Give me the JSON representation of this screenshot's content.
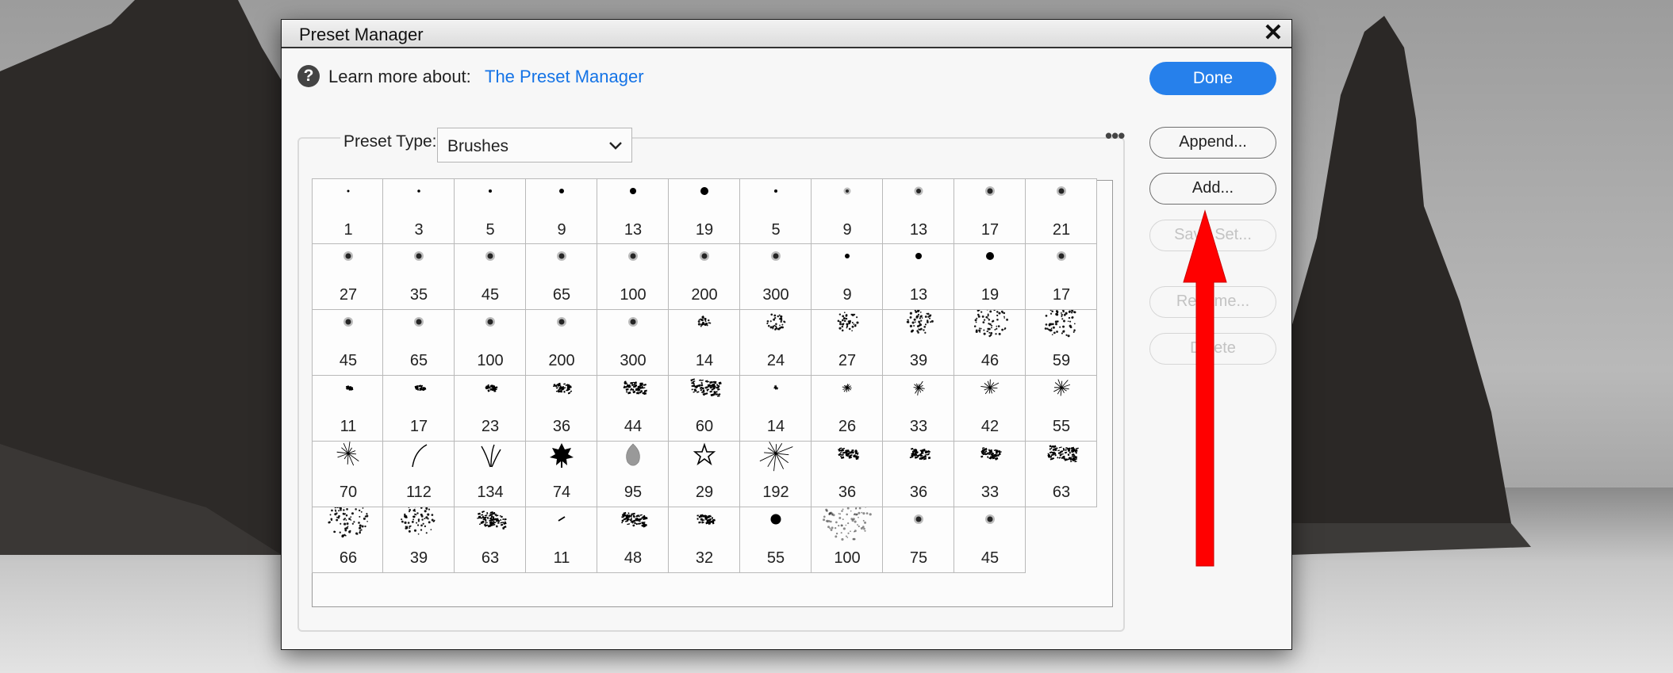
{
  "window": {
    "title": "Preset Manager"
  },
  "header": {
    "learn_label": "Learn more about:",
    "learn_link": "The Preset Manager",
    "done_label": "Done"
  },
  "preset_type": {
    "label": "Preset Type:",
    "value": "Brushes"
  },
  "actions": {
    "append": "Append...",
    "add": "Add...",
    "save_set": "Save Set...",
    "rename": "Rename...",
    "delete": "Delete"
  },
  "brushes": [
    {
      "size": "1",
      "kind": "hard",
      "d": 2
    },
    {
      "size": "3",
      "kind": "hard",
      "d": 2.5
    },
    {
      "size": "5",
      "kind": "hard",
      "d": 3
    },
    {
      "size": "9",
      "kind": "hard",
      "d": 5
    },
    {
      "size": "13",
      "kind": "hard",
      "d": 7
    },
    {
      "size": "19",
      "kind": "hard",
      "d": 9
    },
    {
      "size": "5",
      "kind": "hard",
      "d": 3
    },
    {
      "size": "9",
      "kind": "soft",
      "d": 5
    },
    {
      "size": "13",
      "kind": "soft",
      "d": 7
    },
    {
      "size": "17",
      "kind": "soft",
      "d": 8
    },
    {
      "size": "21",
      "kind": "soft",
      "d": 8
    },
    {
      "size": "27",
      "kind": "soft",
      "d": 8
    },
    {
      "size": "35",
      "kind": "soft",
      "d": 8
    },
    {
      "size": "45",
      "kind": "soft",
      "d": 8
    },
    {
      "size": "65",
      "kind": "soft",
      "d": 8
    },
    {
      "size": "100",
      "kind": "soft",
      "d": 8
    },
    {
      "size": "200",
      "kind": "soft",
      "d": 8
    },
    {
      "size": "300",
      "kind": "soft",
      "d": 8
    },
    {
      "size": "9",
      "kind": "hard",
      "d": 5
    },
    {
      "size": "13",
      "kind": "hard",
      "d": 7
    },
    {
      "size": "19",
      "kind": "hard",
      "d": 9
    },
    {
      "size": "17",
      "kind": "soft",
      "d": 8
    },
    {
      "size": "45",
      "kind": "soft",
      "d": 8
    },
    {
      "size": "65",
      "kind": "soft",
      "d": 8
    },
    {
      "size": "100",
      "kind": "soft",
      "d": 8
    },
    {
      "size": "200",
      "kind": "soft",
      "d": 8
    },
    {
      "size": "300",
      "kind": "soft",
      "d": 8
    },
    {
      "size": "14",
      "kind": "spatter",
      "d": 8
    },
    {
      "size": "24",
      "kind": "spatter",
      "d": 12
    },
    {
      "size": "27",
      "kind": "spatter",
      "d": 14
    },
    {
      "size": "39",
      "kind": "spatter",
      "d": 18
    },
    {
      "size": "46",
      "kind": "spatter",
      "d": 22
    },
    {
      "size": "59",
      "kind": "spatter",
      "d": 22
    },
    {
      "size": "11",
      "kind": "chalk",
      "d": 8
    },
    {
      "size": "17",
      "kind": "chalk",
      "d": 11
    },
    {
      "size": "23",
      "kind": "chalk",
      "d": 14
    },
    {
      "size": "36",
      "kind": "chalk",
      "d": 22
    },
    {
      "size": "44",
      "kind": "chalk",
      "d": 28
    },
    {
      "size": "60",
      "kind": "chalk",
      "d": 36
    },
    {
      "size": "14",
      "kind": "star",
      "d": 3
    },
    {
      "size": "26",
      "kind": "star",
      "d": 6
    },
    {
      "size": "33",
      "kind": "star",
      "d": 9
    },
    {
      "size": "42",
      "kind": "star",
      "d": 12
    },
    {
      "size": "55",
      "kind": "star",
      "d": 14
    },
    {
      "size": "70",
      "kind": "star",
      "d": 16
    },
    {
      "size": "112",
      "kind": "grass1",
      "d": 22
    },
    {
      "size": "134",
      "kind": "grass2",
      "d": 22
    },
    {
      "size": "74",
      "kind": "leaf",
      "d": 22
    },
    {
      "size": "95",
      "kind": "leaf2",
      "d": 22
    },
    {
      "size": "29",
      "kind": "staroutline",
      "d": 22
    },
    {
      "size": "192",
      "kind": "star",
      "d": 22
    },
    {
      "size": "36",
      "kind": "chalk",
      "d": 24
    },
    {
      "size": "36",
      "kind": "chalk",
      "d": 24
    },
    {
      "size": "33",
      "kind": "chalk",
      "d": 24
    },
    {
      "size": "63",
      "kind": "chalk",
      "d": 36
    },
    {
      "size": "66",
      "kind": "spatter",
      "d": 26
    },
    {
      "size": "39",
      "kind": "spatter",
      "d": 22
    },
    {
      "size": "63",
      "kind": "chalk",
      "d": 36
    },
    {
      "size": "11",
      "kind": "dash",
      "d": 8
    },
    {
      "size": "48",
      "kind": "chalk",
      "d": 30
    },
    {
      "size": "32",
      "kind": "chalk",
      "d": 20
    },
    {
      "size": "55",
      "kind": "hard",
      "d": 12
    },
    {
      "size": "100",
      "kind": "spatterlight",
      "d": 30
    },
    {
      "size": "75",
      "kind": "soft",
      "d": 8
    },
    {
      "size": "45",
      "kind": "soft",
      "d": 8
    }
  ],
  "colors": {
    "accent": "#2680eb",
    "link": "#1473e6",
    "arrow": "#ff0000"
  }
}
